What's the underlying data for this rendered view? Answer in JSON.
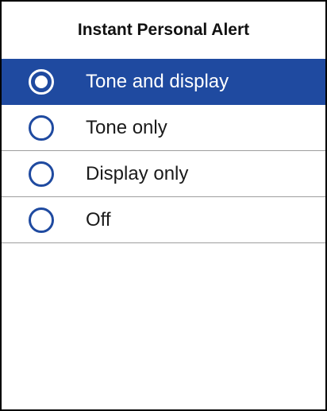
{
  "header": {
    "title": "Instant Personal Alert"
  },
  "options": [
    {
      "label": "Tone and display",
      "selected": true
    },
    {
      "label": "Tone only",
      "selected": false
    },
    {
      "label": "Display only",
      "selected": false
    },
    {
      "label": "Off",
      "selected": false
    }
  ],
  "colors": {
    "selected_background": "#1f4aa0",
    "radio_unselected": "#1f4aa0",
    "radio_selected": "#ffffff",
    "divider": "#9e9e9e"
  }
}
